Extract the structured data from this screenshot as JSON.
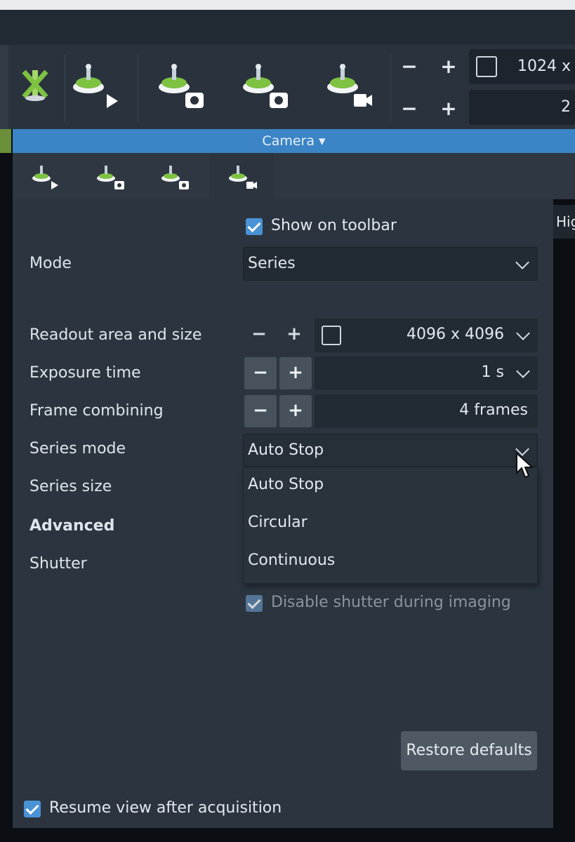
{
  "toolbar": {
    "stepper1": {
      "minus": "−",
      "plus": "+"
    },
    "stepper2": {
      "minus": "−",
      "plus": "+"
    },
    "field1_value": "1024 x",
    "field2_value": "2"
  },
  "camera_bar": {
    "label": "Camera ▾"
  },
  "right_edge": {
    "label": "Hig"
  },
  "settings": {
    "show_on_toolbar": "Show on toolbar",
    "mode": {
      "label": "Mode",
      "value": "Series"
    },
    "readout": {
      "label": "Readout area and size",
      "minus": "−",
      "plus": "+",
      "value": "4096 x 4096"
    },
    "exposure": {
      "label": "Exposure time",
      "minus": "−",
      "plus": "+",
      "value": "1 s"
    },
    "frame_combining": {
      "label": "Frame combining",
      "minus": "−",
      "plus": "+",
      "value": "4 frames"
    },
    "series_mode": {
      "label": "Series mode",
      "value": "Auto Stop",
      "options": [
        "Auto Stop",
        "Circular",
        "Continuous"
      ]
    },
    "series_size": {
      "label": "Series size"
    },
    "advanced": {
      "label": "Advanced"
    },
    "shutter": {
      "label": "Shutter"
    },
    "disable_shutter": "Disable shutter during imaging",
    "restore_defaults": "Restore defaults",
    "resume_view": "Resume view after acquisition"
  },
  "colors": {
    "accent": "#3b84c6",
    "icon_green": "#7ec242",
    "panel_bg": "#2c353f"
  },
  "icons": [
    "camera-disabled-icon",
    "camera-play-icon",
    "camera-snapshot-icon",
    "camera-snapshot-alt-icon",
    "camera-video-icon"
  ]
}
